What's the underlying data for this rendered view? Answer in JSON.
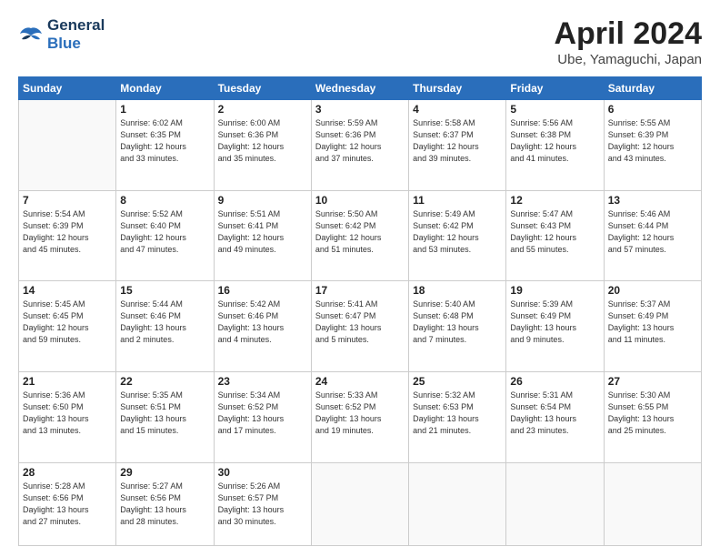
{
  "logo": {
    "line1": "General",
    "line2": "Blue"
  },
  "title": "April 2024",
  "location": "Ube, Yamaguchi, Japan",
  "weekdays": [
    "Sunday",
    "Monday",
    "Tuesday",
    "Wednesday",
    "Thursday",
    "Friday",
    "Saturday"
  ],
  "weeks": [
    [
      {
        "day": "",
        "info": ""
      },
      {
        "day": "1",
        "info": "Sunrise: 6:02 AM\nSunset: 6:35 PM\nDaylight: 12 hours\nand 33 minutes."
      },
      {
        "day": "2",
        "info": "Sunrise: 6:00 AM\nSunset: 6:36 PM\nDaylight: 12 hours\nand 35 minutes."
      },
      {
        "day": "3",
        "info": "Sunrise: 5:59 AM\nSunset: 6:36 PM\nDaylight: 12 hours\nand 37 minutes."
      },
      {
        "day": "4",
        "info": "Sunrise: 5:58 AM\nSunset: 6:37 PM\nDaylight: 12 hours\nand 39 minutes."
      },
      {
        "day": "5",
        "info": "Sunrise: 5:56 AM\nSunset: 6:38 PM\nDaylight: 12 hours\nand 41 minutes."
      },
      {
        "day": "6",
        "info": "Sunrise: 5:55 AM\nSunset: 6:39 PM\nDaylight: 12 hours\nand 43 minutes."
      }
    ],
    [
      {
        "day": "7",
        "info": "Sunrise: 5:54 AM\nSunset: 6:39 PM\nDaylight: 12 hours\nand 45 minutes."
      },
      {
        "day": "8",
        "info": "Sunrise: 5:52 AM\nSunset: 6:40 PM\nDaylight: 12 hours\nand 47 minutes."
      },
      {
        "day": "9",
        "info": "Sunrise: 5:51 AM\nSunset: 6:41 PM\nDaylight: 12 hours\nand 49 minutes."
      },
      {
        "day": "10",
        "info": "Sunrise: 5:50 AM\nSunset: 6:42 PM\nDaylight: 12 hours\nand 51 minutes."
      },
      {
        "day": "11",
        "info": "Sunrise: 5:49 AM\nSunset: 6:42 PM\nDaylight: 12 hours\nand 53 minutes."
      },
      {
        "day": "12",
        "info": "Sunrise: 5:47 AM\nSunset: 6:43 PM\nDaylight: 12 hours\nand 55 minutes."
      },
      {
        "day": "13",
        "info": "Sunrise: 5:46 AM\nSunset: 6:44 PM\nDaylight: 12 hours\nand 57 minutes."
      }
    ],
    [
      {
        "day": "14",
        "info": "Sunrise: 5:45 AM\nSunset: 6:45 PM\nDaylight: 12 hours\nand 59 minutes."
      },
      {
        "day": "15",
        "info": "Sunrise: 5:44 AM\nSunset: 6:46 PM\nDaylight: 13 hours\nand 2 minutes."
      },
      {
        "day": "16",
        "info": "Sunrise: 5:42 AM\nSunset: 6:46 PM\nDaylight: 13 hours\nand 4 minutes."
      },
      {
        "day": "17",
        "info": "Sunrise: 5:41 AM\nSunset: 6:47 PM\nDaylight: 13 hours\nand 5 minutes."
      },
      {
        "day": "18",
        "info": "Sunrise: 5:40 AM\nSunset: 6:48 PM\nDaylight: 13 hours\nand 7 minutes."
      },
      {
        "day": "19",
        "info": "Sunrise: 5:39 AM\nSunset: 6:49 PM\nDaylight: 13 hours\nand 9 minutes."
      },
      {
        "day": "20",
        "info": "Sunrise: 5:37 AM\nSunset: 6:49 PM\nDaylight: 13 hours\nand 11 minutes."
      }
    ],
    [
      {
        "day": "21",
        "info": "Sunrise: 5:36 AM\nSunset: 6:50 PM\nDaylight: 13 hours\nand 13 minutes."
      },
      {
        "day": "22",
        "info": "Sunrise: 5:35 AM\nSunset: 6:51 PM\nDaylight: 13 hours\nand 15 minutes."
      },
      {
        "day": "23",
        "info": "Sunrise: 5:34 AM\nSunset: 6:52 PM\nDaylight: 13 hours\nand 17 minutes."
      },
      {
        "day": "24",
        "info": "Sunrise: 5:33 AM\nSunset: 6:52 PM\nDaylight: 13 hours\nand 19 minutes."
      },
      {
        "day": "25",
        "info": "Sunrise: 5:32 AM\nSunset: 6:53 PM\nDaylight: 13 hours\nand 21 minutes."
      },
      {
        "day": "26",
        "info": "Sunrise: 5:31 AM\nSunset: 6:54 PM\nDaylight: 13 hours\nand 23 minutes."
      },
      {
        "day": "27",
        "info": "Sunrise: 5:30 AM\nSunset: 6:55 PM\nDaylight: 13 hours\nand 25 minutes."
      }
    ],
    [
      {
        "day": "28",
        "info": "Sunrise: 5:28 AM\nSunset: 6:56 PM\nDaylight: 13 hours\nand 27 minutes."
      },
      {
        "day": "29",
        "info": "Sunrise: 5:27 AM\nSunset: 6:56 PM\nDaylight: 13 hours\nand 28 minutes."
      },
      {
        "day": "30",
        "info": "Sunrise: 5:26 AM\nSunset: 6:57 PM\nDaylight: 13 hours\nand 30 minutes."
      },
      {
        "day": "",
        "info": ""
      },
      {
        "day": "",
        "info": ""
      },
      {
        "day": "",
        "info": ""
      },
      {
        "day": "",
        "info": ""
      }
    ]
  ]
}
